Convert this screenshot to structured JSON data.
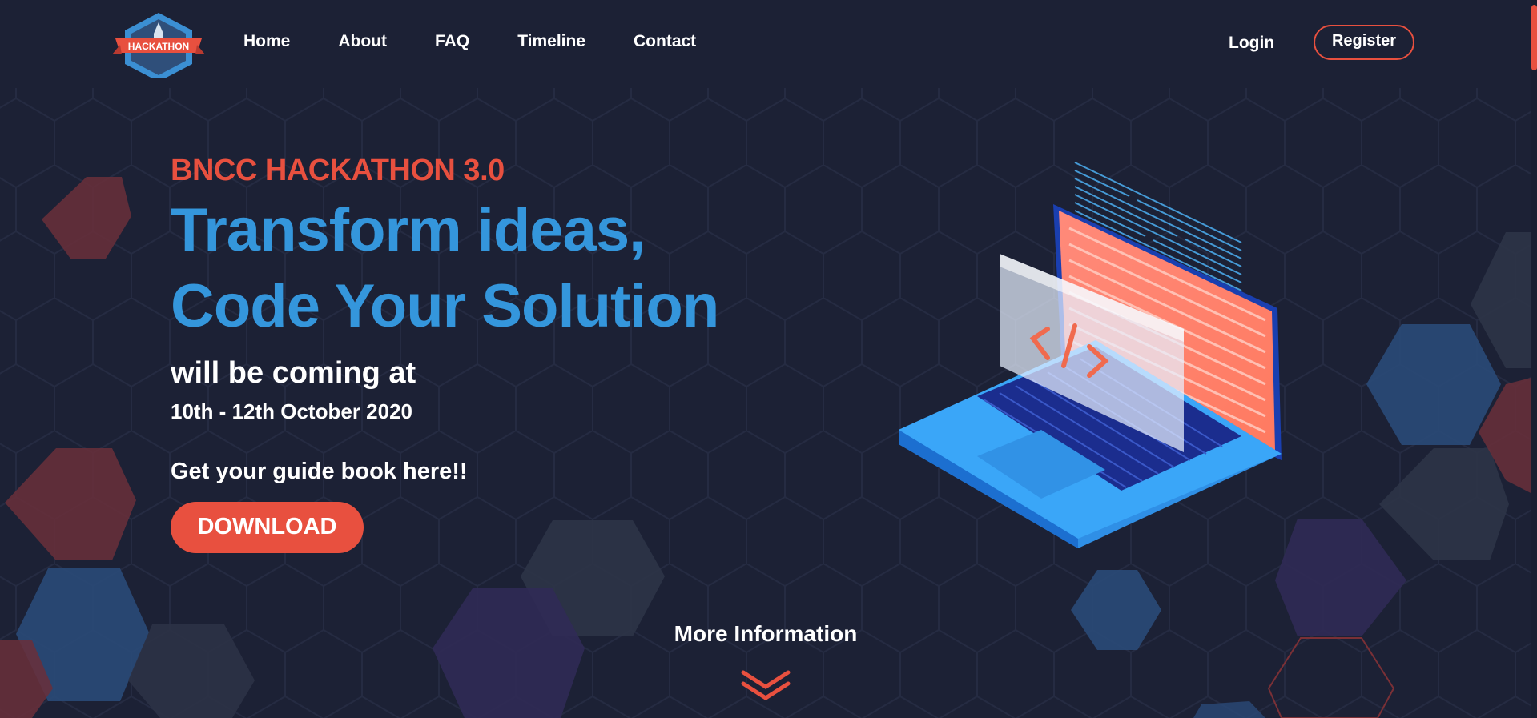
{
  "brand": {
    "logo_text": "HACKATHON",
    "accent_color": "#e8503f",
    "primary_color": "#3496dc",
    "background_color": "#1c2135"
  },
  "nav": {
    "items": [
      {
        "label": "Home"
      },
      {
        "label": "About"
      },
      {
        "label": "FAQ"
      },
      {
        "label": "Timeline"
      },
      {
        "label": "Contact"
      }
    ],
    "login_label": "Login",
    "register_label": "Register"
  },
  "hero": {
    "eyebrow": "BNCC HACKATHON 3.0",
    "headline_line1": "Transform ideas,",
    "headline_line2": "Code Your Solution",
    "subheading": "will be coming at",
    "date": "10th - 12th October 2020",
    "guide_text": "Get your guide book here!!",
    "download_label": "DOWNLOAD"
  },
  "footer_cta": {
    "more_info_label": "More Information",
    "icon": "chevron-double-down-icon"
  },
  "illustration": {
    "icon": "code-tag-icon",
    "code_glyph": "</>"
  }
}
